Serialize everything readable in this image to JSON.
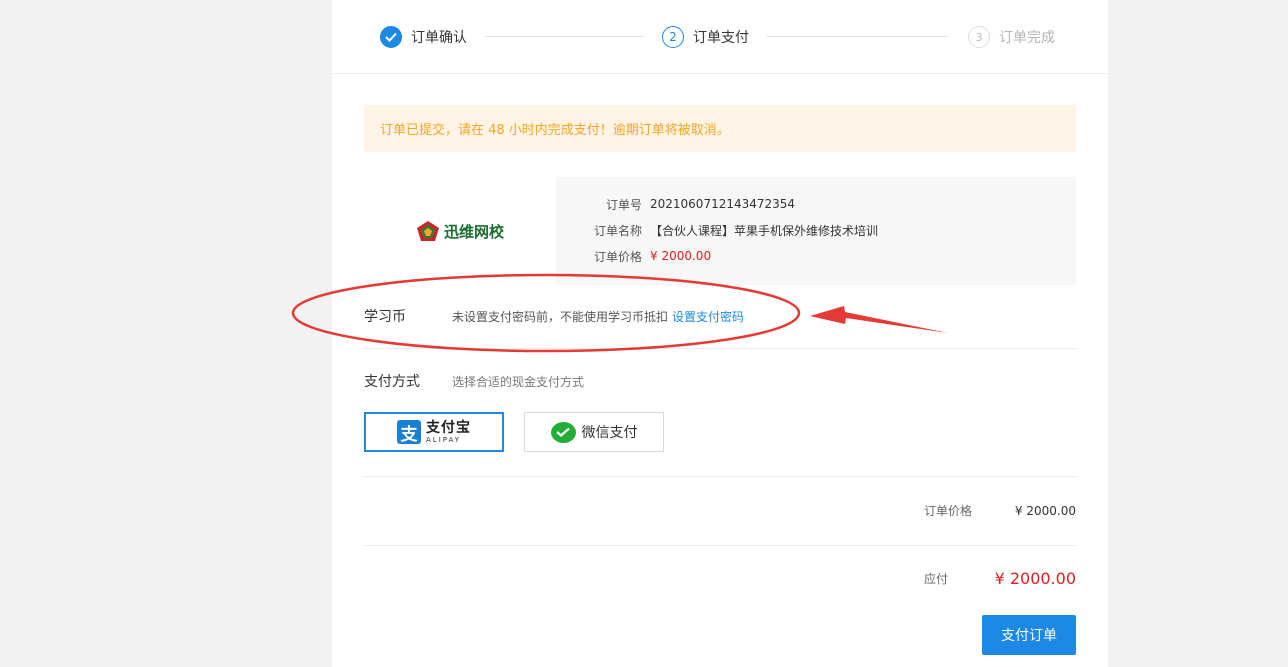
{
  "steps": [
    {
      "num": "✓",
      "label": "订单确认"
    },
    {
      "num": "2",
      "label": "订单支付"
    },
    {
      "num": "3",
      "label": "订单完成"
    }
  ],
  "notice": "订单已提交，请在 48 小时内完成支付！逾期订单将被取消。",
  "order": {
    "logo_text": "迅维网校",
    "rows": [
      {
        "key": "订单号",
        "value": "2021060712143472354"
      },
      {
        "key": "订单名称",
        "value": "【合伙人课程】苹果手机保外维修技术培训"
      },
      {
        "key": "订单价格",
        "value": "¥ 2000.00"
      }
    ]
  },
  "coin": {
    "label": "学习币",
    "note": "未设置支付密码前，不能使用学习币抵扣",
    "link": "设置支付密码"
  },
  "payment": {
    "label": "支付方式",
    "hint": "选择合适的现金支付方式",
    "alipay_cn": "支付宝",
    "alipay_en": "ALIPAY",
    "alipay_mark": "支",
    "wechat_label": "微信支付"
  },
  "summary": {
    "price_label": "订单价格",
    "price_value": "¥ 2000.00",
    "due_label": "应付",
    "due_value": "¥ 2000.00"
  },
  "submit_label": "支付订单",
  "colors": {
    "primary": "#1e88e5",
    "price_red": "#e02020",
    "notice_bg": "#fff4e5",
    "notice_text": "#f5a623",
    "annotation_red": "#e53935"
  }
}
